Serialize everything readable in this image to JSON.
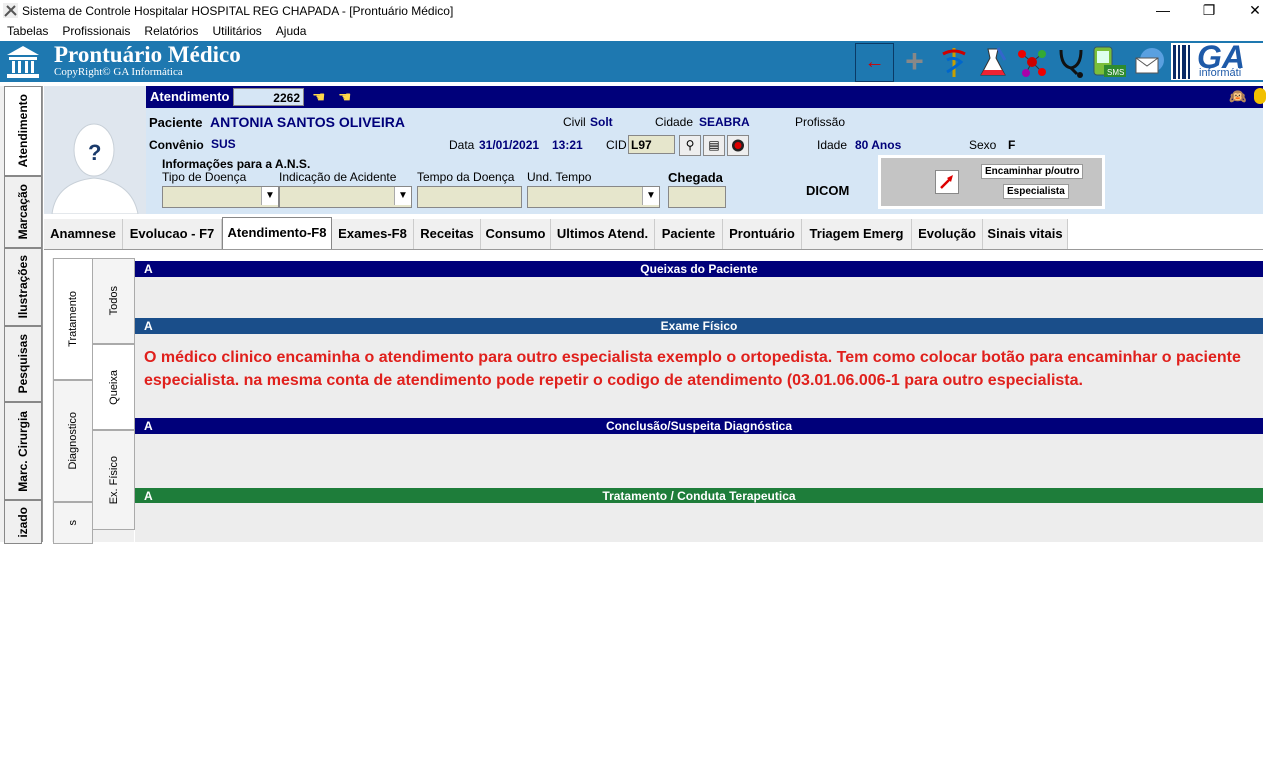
{
  "window": {
    "title": "Sistema de Controle Hospitalar HOSPITAL REG CHAPADA - [Prontuário Médico]",
    "minimize": "—",
    "restore": "❐",
    "close": "✕"
  },
  "menu": [
    "Tabelas",
    "Profissionais",
    "Relatórios",
    "Utilitários",
    "Ajuda"
  ],
  "banner": {
    "title": "Prontuário Médico",
    "copyright": "CopyRight© GA Informática",
    "logo_text": "GA",
    "logo_sub": "informáti"
  },
  "toolbar_icons": [
    "back-arrow-icon",
    "plus-icon",
    "caduceus-icon",
    "lab-flask-icon",
    "molecule-icon",
    "stethoscope-icon",
    "sms-phone-icon",
    "email-icon",
    "barcode-icon"
  ],
  "side_tabs": [
    "Atendimento",
    "Marcação",
    "Ilustrações",
    "Pesquisas",
    "Marc. Cirurgia",
    "izado"
  ],
  "atendimento": {
    "label": "Atendimento",
    "number": "2262"
  },
  "patient": {
    "label": "Paciente",
    "name": "ANTONIA SANTOS OLIVEIRA",
    "civil_label": "Civil",
    "civil": "Solt",
    "cidade_label": "Cidade",
    "cidade": "SEABRA",
    "profissao_label": "Profissão",
    "convenio_label": "Convênio",
    "convenio": "SUS",
    "data_label": "Data",
    "data": "31/01/2021",
    "hora": "13:21",
    "cid_label": "CID",
    "cid": "L97",
    "idade_label": "Idade",
    "idade": "80 Anos",
    "sexo_label": "Sexo",
    "sexo": "F"
  },
  "ans": {
    "title": "Informações para a A.N.S.",
    "tipo_doenca": "Tipo de Doença",
    "indicacao_acidente": "Indicação de Acidente",
    "tempo_doenca": "Tempo da Doença",
    "und_tempo": "Und. Tempo",
    "chegada": "Chegada",
    "dicom": "DICOM"
  },
  "encaminhar": {
    "line1": "Encaminhar p/outro",
    "line2": "Especialista"
  },
  "tabs": [
    "Anamnese",
    "Evolucao - F7",
    "Atendimento-F8",
    "Exames-F8",
    "Receitas",
    "Consumo",
    "Ultimos Atend.",
    "Paciente",
    "Prontuário",
    "Triagem Emerg",
    "Evolução",
    "Sinais vitais"
  ],
  "inner_tabs": [
    "Tratamento",
    "Diagnostico",
    "s"
  ],
  "sub_tabs": [
    "Todos",
    "Queixa",
    "Ex. Físico"
  ],
  "sections": {
    "a_label": "A",
    "queixas": "Queixas do Paciente",
    "exame": "Exame Físico",
    "conclusao": "Conclusão/Suspeita Diagnóstica",
    "tratamento": "Tratamento / Conduta Terapeutica"
  },
  "exame_text": "O médico clinico encaminha o atendimento para outro especialista exemplo o ortopedista. Tem como colocar botão para encaminhar o paciente especialista.  na mesma conta de atendimento pode  repetir o codigo de atendimento (03.01.06.006-1 para outro especialista.",
  "colors": {
    "banner": "#1e78b0",
    "navy": "#00007a",
    "green_bar": "#1e7d3a",
    "header_panel": "#d6e6f5",
    "red_text": "#e0201c"
  }
}
